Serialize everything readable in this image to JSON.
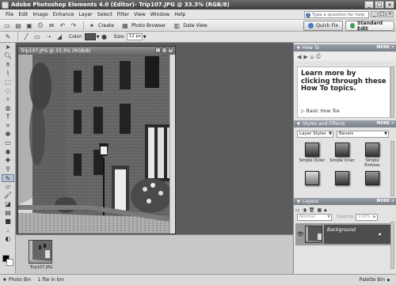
{
  "window": {
    "title": "Adobe Photoshop Elements 4.0 (Editor)",
    "document_suffix": " - Trip107.JPG @ 33.3% (RGB/8)",
    "buttons": [
      "_",
      "□",
      "×"
    ]
  },
  "menubar": {
    "items": [
      "File",
      "Edit",
      "Image",
      "Enhance",
      "Layer",
      "Select",
      "Filter",
      "View",
      "Window",
      "Help"
    ],
    "help_placeholder": "Type a question for help"
  },
  "shortcuts": {
    "create_label": "Create",
    "photo_browser_label": "Photo Browser",
    "date_view_label": "Date View",
    "quick_fix_label": "Quick Fix",
    "standard_edit_label": "Standard Edit"
  },
  "options": {
    "color_label": "Color:",
    "size_label": "Size:",
    "size_value": "12 px",
    "color_value": "#555555"
  },
  "document": {
    "title": "Trip107.JPG @ 33.3% (RGB/8)"
  },
  "photobin": {
    "thumb_label": "Trip107.JPG"
  },
  "statusbar": {
    "photo_bin_label": "Photo Bin",
    "files_label": "1 file in bin",
    "palette_bin_label": "Palette Bin"
  },
  "palette": {
    "howto": {
      "title": "How To",
      "more": "MORE",
      "headline": "Learn more by clicking through these How To topics.",
      "link": "Basic How Tos"
    },
    "styles": {
      "title": "Styles and Effects",
      "more": "MORE",
      "category": "Layer Styles",
      "subcategory": "Bevels",
      "items": [
        "Simple Outer",
        "Simple Inner",
        "Simple Emboss",
        "",
        "",
        ""
      ]
    },
    "layers": {
      "title": "Layers",
      "more": "MORE",
      "blend_mode": "Normal",
      "opacity_label": "Opacity:",
      "opacity_value": "100%",
      "layer_name": "Background"
    }
  }
}
